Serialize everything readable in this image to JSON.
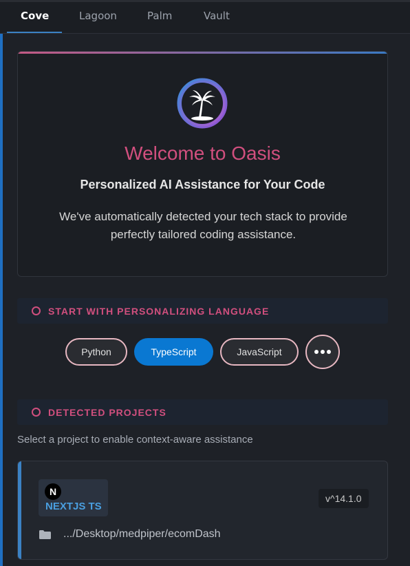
{
  "tabs": [
    {
      "label": "Cove",
      "active": true
    },
    {
      "label": "Lagoon",
      "active": false
    },
    {
      "label": "Palm",
      "active": false
    },
    {
      "label": "Vault",
      "active": false
    }
  ],
  "welcome": {
    "title": "Welcome to Oasis",
    "subtitle": "Personalized AI Assistance for Your Code",
    "description": "We've automatically detected your tech stack to provide perfectly tailored coding assistance.",
    "logo_icon": "palm-tree-icon"
  },
  "language_section": {
    "header": "START WITH PERSONALIZING LANGUAGE",
    "languages": [
      {
        "label": "Python",
        "selected": false
      },
      {
        "label": "TypeScript",
        "selected": true
      },
      {
        "label": "JavaScript",
        "selected": false
      }
    ],
    "more_icon": "more-horizontal-icon"
  },
  "projects_section": {
    "header": "DETECTED PROJECTS",
    "hint": "Select a project to enable context-aware assistance",
    "projects": [
      {
        "framework_logo": "N",
        "framework": "NEXTJS TS",
        "version": "v^14.1.0",
        "path": ".../Desktop/medpiper/ecomDash"
      }
    ]
  },
  "colors": {
    "accent_pink": "#d14f7e",
    "accent_blue": "#0a78d2",
    "background": "#1e2127"
  }
}
